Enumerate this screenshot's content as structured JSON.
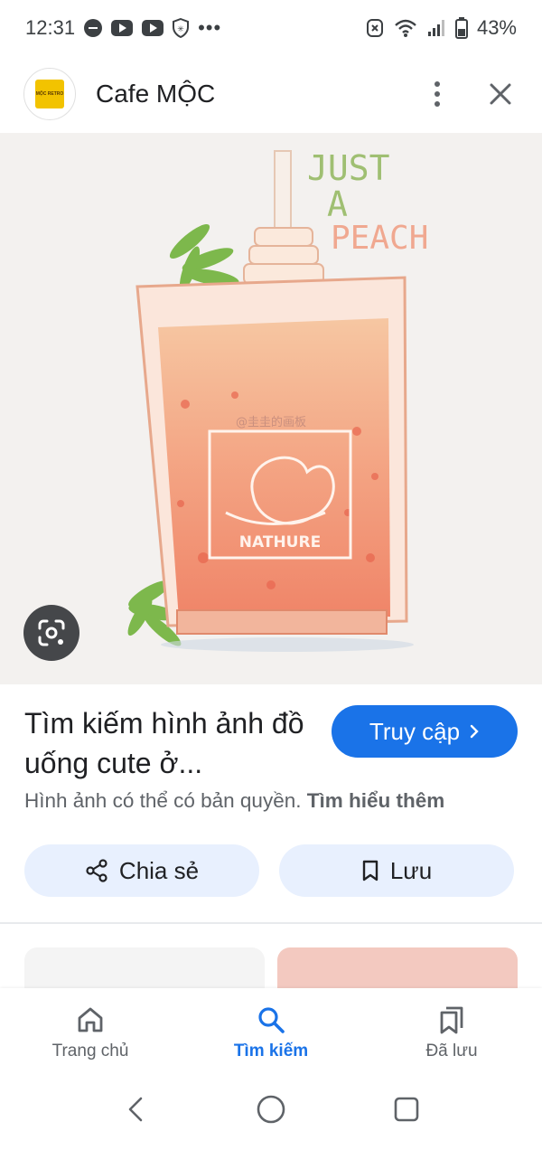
{
  "status_bar": {
    "time": "12:31",
    "battery": "43%"
  },
  "header": {
    "logo_text": "MỘC RETRO",
    "title": "Cafe MỘC"
  },
  "hero": {
    "caption_lines": [
      "JUST",
      "A",
      "PEACH"
    ],
    "label_text": "NATHURE",
    "watermark": "@圭圭的画板"
  },
  "result": {
    "title": "Tìm kiếm hình ảnh đồ uống cute ở...",
    "visit_label": "Truy cập",
    "copyright_text": "Hình ảnh có thể có bản quyền.",
    "learn_more": "Tìm hiểu thêm"
  },
  "actions": {
    "share_label": "Chia sẻ",
    "save_label": "Lưu"
  },
  "bottom_nav": {
    "items": [
      {
        "label": "Trang chủ",
        "icon": "home-icon"
      },
      {
        "label": "Tìm kiếm",
        "icon": "search-icon",
        "active": true
      },
      {
        "label": "Đã lưu",
        "icon": "bookmarks-icon"
      }
    ]
  },
  "colors": {
    "accent": "#1a73e8",
    "chip_bg": "#e8f0fe",
    "drink": "#f2a07f"
  }
}
